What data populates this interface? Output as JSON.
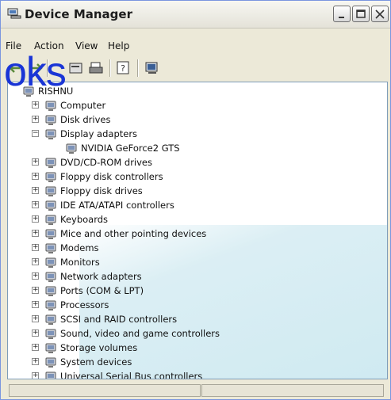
{
  "window": {
    "title": "Device Manager"
  },
  "menu": [
    "File",
    "Action",
    "View",
    "Help"
  ],
  "overlay_text": "oks",
  "tree": {
    "root": "RISHNU",
    "categories": [
      {
        "label": "Computer",
        "expanded": false,
        "icon": "computer-icon"
      },
      {
        "label": "Disk drives",
        "expanded": false,
        "icon": "disk-drive-icon"
      },
      {
        "label": "Display adapters",
        "expanded": true,
        "icon": "display-adapter-icon",
        "children": [
          "NVIDIA GeForce2 GTS"
        ]
      },
      {
        "label": "DVD/CD-ROM drives",
        "expanded": false,
        "icon": "cdrom-icon"
      },
      {
        "label": "Floppy disk controllers",
        "expanded": false,
        "icon": "controller-icon"
      },
      {
        "label": "Floppy disk drives",
        "expanded": false,
        "icon": "floppy-icon"
      },
      {
        "label": "IDE ATA/ATAPI controllers",
        "expanded": false,
        "icon": "ide-controller-icon"
      },
      {
        "label": "Keyboards",
        "expanded": false,
        "icon": "keyboard-icon"
      },
      {
        "label": "Mice and other pointing devices",
        "expanded": false,
        "icon": "mouse-icon"
      },
      {
        "label": "Modems",
        "expanded": false,
        "icon": "modem-icon"
      },
      {
        "label": "Monitors",
        "expanded": false,
        "icon": "monitor-icon"
      },
      {
        "label": "Network adapters",
        "expanded": false,
        "icon": "network-adapter-icon"
      },
      {
        "label": "Ports (COM & LPT)",
        "expanded": false,
        "icon": "port-icon"
      },
      {
        "label": "Processors",
        "expanded": false,
        "icon": "processor-icon"
      },
      {
        "label": "SCSI and RAID controllers",
        "expanded": false,
        "icon": "scsi-icon"
      },
      {
        "label": "Sound, video and game controllers",
        "expanded": false,
        "icon": "sound-icon"
      },
      {
        "label": "Storage volumes",
        "expanded": false,
        "icon": "storage-volume-icon"
      },
      {
        "label": "System devices",
        "expanded": false,
        "icon": "system-device-icon"
      },
      {
        "label": "Universal Serial Bus controllers",
        "expanded": false,
        "icon": "usb-icon"
      }
    ]
  },
  "colors": {
    "overlay": "#1a35d6",
    "window_border": "#7a96df",
    "tree_border": "#7f9db9"
  }
}
